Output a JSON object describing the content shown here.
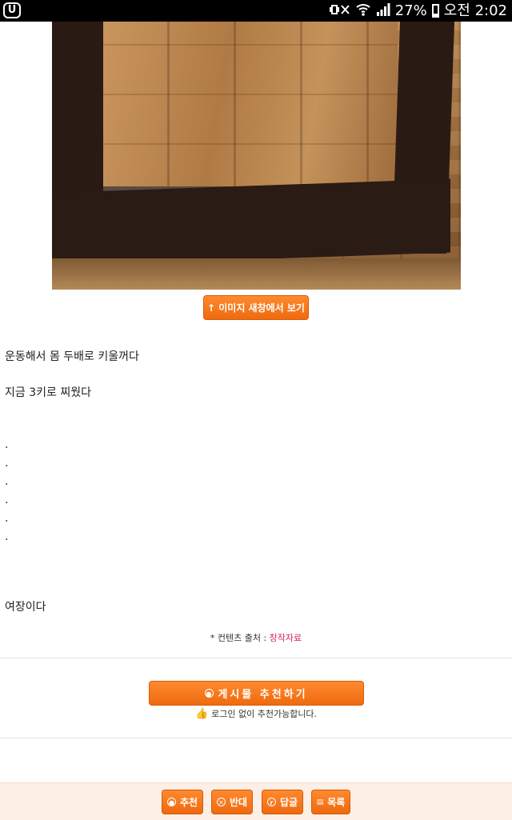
{
  "status_bar": {
    "app_icon": "U",
    "battery_percent": "27%",
    "battery_level": 0.27,
    "time": "오전 2:02",
    "icons": [
      "mute-vibrate-icon",
      "wifi-icon",
      "signal-icon",
      "battery-icon"
    ]
  },
  "post": {
    "image_alt": "photo-mirror-on-wood-floor",
    "view_image_button": "↑ 이미지 새창에서 보기",
    "lines": [
      "운동해서 몸 두배로 키울꺼다",
      "지금 3키로 찌웠다",
      ".",
      ".",
      ".",
      ".",
      ".",
      ".",
      "여장이다"
    ],
    "source_label": "* 컨텐츠 출처 :",
    "source_link": "창작자료"
  },
  "recommend": {
    "button_label": "게시물 추천하기",
    "note": "로그인 없이 추천가능합니다."
  },
  "bottom_bar": {
    "buttons": [
      {
        "label": "추천",
        "icon": "recommend-icon"
      },
      {
        "label": "반대",
        "icon": "oppose-icon"
      },
      {
        "label": "답글",
        "icon": "reply-icon"
      },
      {
        "label": "목록",
        "icon": "list-icon"
      }
    ]
  },
  "colors": {
    "accent_orange": "#ef6a0f",
    "source_link": "#d6245b",
    "bottom_bar_bg": "#fbefe6"
  }
}
